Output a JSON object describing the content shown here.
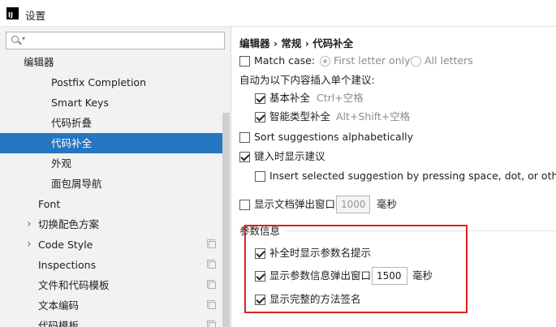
{
  "window": {
    "title": "设置",
    "app_icon_text": "IJ"
  },
  "search": {
    "value": ""
  },
  "tree": [
    {
      "label": "编辑器",
      "indent": 29,
      "selected": false,
      "arrow": false,
      "copy": false
    },
    {
      "label": "Postfix Completion",
      "indent": 63,
      "selected": false,
      "arrow": false,
      "copy": false
    },
    {
      "label": "Smart Keys",
      "indent": 63,
      "selected": false,
      "arrow": false,
      "copy": false
    },
    {
      "label": "代码折叠",
      "indent": 63,
      "selected": false,
      "arrow": false,
      "copy": false
    },
    {
      "label": "代码补全",
      "indent": 63,
      "selected": true,
      "arrow": false,
      "copy": false
    },
    {
      "label": "外观",
      "indent": 63,
      "selected": false,
      "arrow": false,
      "copy": false
    },
    {
      "label": "面包屑导航",
      "indent": 63,
      "selected": false,
      "arrow": false,
      "copy": false
    },
    {
      "label": "Font",
      "indent": 47,
      "selected": false,
      "arrow": false,
      "copy": false
    },
    {
      "label": "切换配色方案",
      "indent": 47,
      "selected": false,
      "arrow": true,
      "copy": false
    },
    {
      "label": "Code Style",
      "indent": 47,
      "selected": false,
      "arrow": true,
      "copy": true
    },
    {
      "label": "Inspections",
      "indent": 47,
      "selected": false,
      "arrow": false,
      "copy": true
    },
    {
      "label": "文件和代码模板",
      "indent": 47,
      "selected": false,
      "arrow": false,
      "copy": true
    },
    {
      "label": "文本编码",
      "indent": 47,
      "selected": false,
      "arrow": false,
      "copy": true
    },
    {
      "label": "代码模板",
      "indent": 47,
      "selected": false,
      "arrow": false,
      "copy": true
    }
  ],
  "breadcrumb": {
    "text": "编辑器 › 常规 › 代码补全"
  },
  "settings": {
    "match_case": {
      "label": "Match case:",
      "checked": false
    },
    "first_letter": {
      "label": "First letter only",
      "selected": true
    },
    "all_letters": {
      "label": "All letters",
      "selected": false
    },
    "auto_insert": "自动为以下内容插入单个建议:",
    "basic": {
      "label": "基本补全",
      "shortcut": "Ctrl+空格",
      "checked": true
    },
    "smart": {
      "label": "智能类型补全",
      "shortcut": "Alt+Shift+空格",
      "checked": true
    },
    "sort": {
      "label": "Sort suggestions alphabetically",
      "checked": false
    },
    "show_on_type": {
      "label": "键入时显示建议",
      "checked": true
    },
    "insert_selected": {
      "label": "Insert selected suggestion by pressing space, dot, or other c",
      "checked": false
    },
    "doc_popup": {
      "label": "显示文档弹出窗口",
      "value": "1000",
      "unit": "毫秒",
      "checked": false
    },
    "param_section": "参数信息",
    "param_names": {
      "label": "补全时显示参数名提示",
      "checked": true
    },
    "param_popup": {
      "label": "显示参数信息弹出窗口",
      "value": "1500",
      "unit": "毫秒",
      "checked": true
    },
    "full_sig": {
      "label": "显示完整的方法签名",
      "checked": true
    }
  },
  "colors": {
    "selection": "#2675bf",
    "highlight_box": "#e02020"
  }
}
